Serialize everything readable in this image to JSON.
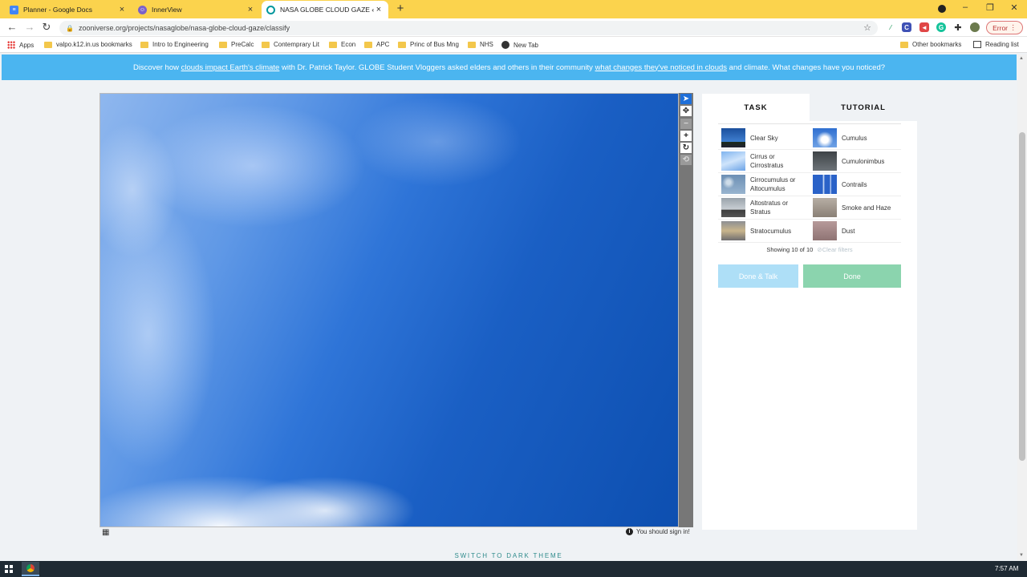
{
  "browser": {
    "tabs": [
      {
        "title": "Planner - Google Docs",
        "active": false
      },
      {
        "title": "InnerView",
        "active": false
      },
      {
        "title": "NASA GLOBE CLOUD GAZE « Cla",
        "active": true
      }
    ],
    "url": "zooniverse.org/projects/nasaglobe/nasa-globe-cloud-gaze/classify",
    "error_label": "Error",
    "bookmarks": [
      "Apps",
      "valpo.k12.in.us bookmarks",
      "Intro to Engineering",
      "PreCalc",
      "Contemprary Lit",
      "Econ",
      "APC",
      "Princ of Bus Mng",
      "NHS",
      "New Tab"
    ],
    "other_bookmarks": "Other bookmarks",
    "reading_list": "Reading list"
  },
  "announcement": {
    "part1": "Discover how ",
    "link1": "clouds impact Earth's climate",
    "part2": " with Dr. Patrick Taylor. GLOBE Student Vloggers asked elders and others in their community ",
    "link2": "what changes they've noticed in clouds",
    "part3": " and climate. What changes have you noticed?"
  },
  "panel": {
    "tab_task": "TASK",
    "tab_tutorial": "TUTORIAL",
    "choices": [
      {
        "label": "Clear Sky"
      },
      {
        "label": "Cumulus"
      },
      {
        "label": "Cirrus or Cirrostratus"
      },
      {
        "label": "Cumulonimbus"
      },
      {
        "label": "Cirrocumulus or Altocumulus"
      },
      {
        "label": "Contrails"
      },
      {
        "label": "Altostratus or Stratus"
      },
      {
        "label": "Smoke and Haze"
      },
      {
        "label": "Stratocumulus"
      },
      {
        "label": "Dust"
      }
    ],
    "showing": "Showing 10 of 10",
    "clear_filters": "Clear filters",
    "done_talk": "Done & Talk",
    "done": "Done"
  },
  "signin_notice": "You should sign in!",
  "dark_theme": "SWITCH TO DARK THEME",
  "clock": "7:57 AM",
  "colors": {
    "announce_bg": "#4bb5f0",
    "done": "#8bd4ae",
    "done_talk": "#aedff7",
    "tab_strip": "#fbd34d"
  }
}
